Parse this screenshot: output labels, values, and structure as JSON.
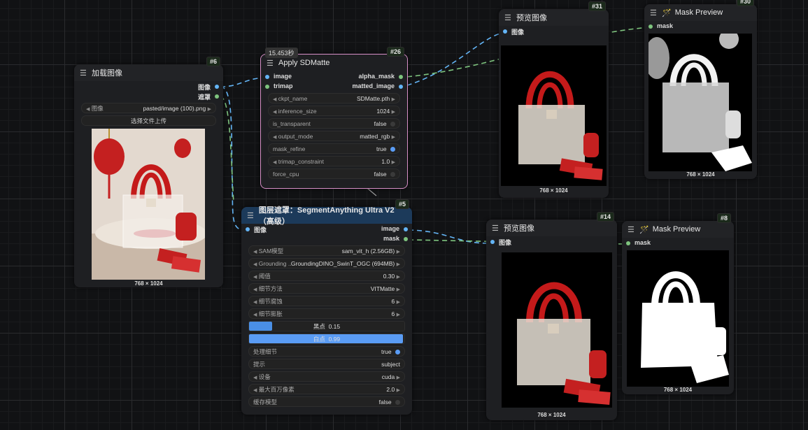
{
  "nodes": {
    "load": {
      "id": "#6",
      "title": "加载图像",
      "outputs": [
        "图像",
        "遮罩"
      ],
      "image_widget": {
        "label": "图像",
        "value": "pasted/image (100).png"
      },
      "upload_button": "选择文件上传",
      "caption": "768 × 1024"
    },
    "sdmatte": {
      "id": "#26",
      "title": "Apply SDMatte",
      "time": "15.453秒",
      "inputs": [
        "image",
        "trimap"
      ],
      "outputs": [
        "alpha_mask",
        "matted_image"
      ],
      "widgets": [
        {
          "label": "ckpt_name",
          "value": "SDMatte.pth"
        },
        {
          "label": "inference_size",
          "value": "1024"
        },
        {
          "label": "is_transparent",
          "value": "false"
        },
        {
          "label": "output_mode",
          "value": "matted_rgb"
        },
        {
          "label": "mask_refine",
          "value": "true"
        },
        {
          "label": "trimap_constraint",
          "value": "1.0"
        },
        {
          "label": "force_cpu",
          "value": "false"
        }
      ]
    },
    "sam": {
      "id": "#5",
      "title": "图层遮罩：SegmentAnything Ultra V2（高级）",
      "inputs": [
        "图像"
      ],
      "outputs": [
        "image",
        "mask"
      ],
      "widgets": [
        {
          "label": "SAM模型",
          "value": "sam_vit_h (2.56GB)"
        },
        {
          "label": "Grounding ...",
          "value": "GroundingDINO_SwinT_OGC (694MB)"
        },
        {
          "label": "阈值",
          "value": "0.30"
        },
        {
          "label": "细节方法",
          "value": "VITMatte"
        },
        {
          "label": "细节腐蚀",
          "value": "6"
        },
        {
          "label": "细节膨胀",
          "value": "6"
        }
      ],
      "black_point": {
        "label": "黑点",
        "value": "0.15",
        "fraction": 0.15
      },
      "white_point": {
        "label": "白点",
        "value": "0.99",
        "fraction": 0.99
      },
      "widgets2": [
        {
          "label": "处理细节",
          "value": "true"
        },
        {
          "label": "提示",
          "value": "subject"
        },
        {
          "label": "设备",
          "value": "cuda"
        },
        {
          "label": "最大百万像素",
          "value": "2.0"
        },
        {
          "label": "缓存模型",
          "value": "false"
        }
      ]
    },
    "preview31": {
      "id": "#31",
      "title": "预览图像",
      "input": "图像",
      "caption": "768 × 1024"
    },
    "mask30": {
      "id": "#30",
      "title": "Mask Preview",
      "input": "mask",
      "caption": "768 × 1024"
    },
    "preview14": {
      "id": "#14",
      "title": "预览图像",
      "input": "图像",
      "caption": "768 × 1024"
    },
    "mask8": {
      "id": "#8",
      "title": "Mask Preview",
      "input": "mask",
      "caption": "768 × 1024"
    }
  },
  "colors": {
    "image_wire": "#64b5f6",
    "mask_wire": "#7ec47e",
    "sdmatte_border": "#d68fc6",
    "sam_header": "#1c3a5a"
  },
  "icons": {
    "menu": "menu-icon",
    "wand": "wand-icon"
  }
}
